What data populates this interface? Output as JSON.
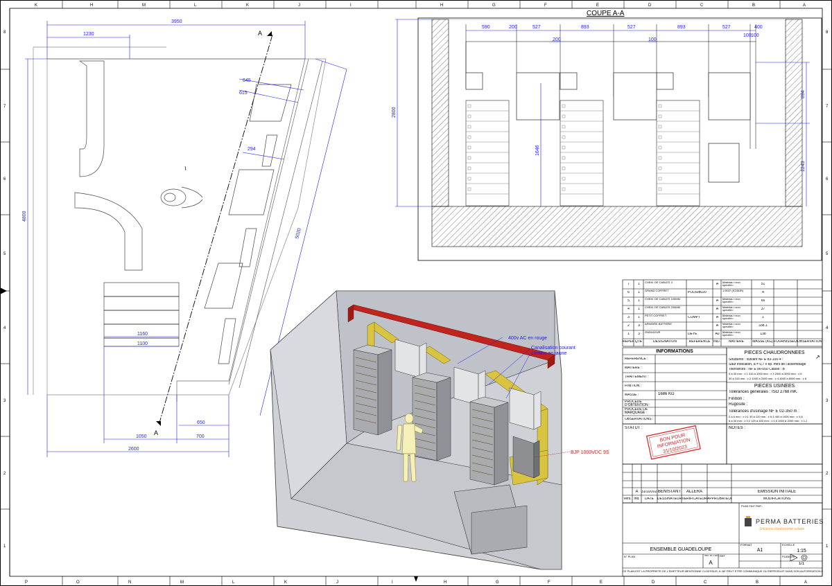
{
  "frame": {
    "col_letters_top": [
      "K",
      "H",
      "M",
      "L",
      "K",
      "J",
      "I",
      "H",
      "G",
      "F",
      "E",
      "D",
      "C",
      "B",
      "A"
    ],
    "col_letters_bottom": [
      "P",
      "O",
      "N",
      "M",
      "L",
      "K",
      "J",
      "I",
      "H",
      "G",
      "F",
      "E",
      "D",
      "C",
      "B",
      "A"
    ],
    "row_numbers_left": [
      "8",
      "7",
      "6",
      "5",
      "4",
      "3",
      "2",
      "1"
    ],
    "row_numbers_right": [
      "8",
      "7",
      "6",
      "5",
      "4",
      "3",
      "2",
      "1"
    ]
  },
  "plan_view": {
    "dims": {
      "top_total": "3950",
      "top_left": "1230",
      "left_height": "4800",
      "diag_long": "5020",
      "d645": "645",
      "d615": "615",
      "d294": "294",
      "w1160": "1160",
      "w1100": "1100",
      "d650": "650",
      "d1050": "1050",
      "d700": "700",
      "bottom_total": "2600"
    },
    "section_marker": "A",
    "section_marker_bottom": "A"
  },
  "section_view": {
    "title": "COUPE A-A",
    "dims": {
      "d590": "590",
      "d200a": "200",
      "d527a": "527",
      "d893a": "893",
      "d527b": "527",
      "d893b": "893",
      "d527c": "527",
      "d400": "400",
      "d100a": "100",
      "d100b": "100",
      "d200b": "200",
      "d100c": "100",
      "height2800": "2800",
      "h1646": "1646",
      "h894": "894",
      "h1243": "1243"
    }
  },
  "iso_view": {
    "labels": {
      "ac": "400v AC en rouge",
      "dc_line1": "Canalisation courant",
      "dc_line2": "continu en jaune",
      "bjp": "BJP 1000VDC 9S"
    }
  },
  "parts_table": {
    "header": [
      "REPERE",
      "QTE",
      "DESIGNATION",
      "REFERENCE",
      "IND.",
      "MATIERE",
      "MASSE (KG)",
      "FOURNISSEUR",
      "OBSERVATIONS"
    ],
    "rows": [
      {
        "rep": "7",
        "qte": "1",
        "des": "CHEM. DE CABLES 3",
        "ref": "",
        "ind": "A",
        "mat": "Matériau <non spécifié>",
        "masse": "51"
      },
      {
        "rep": "6",
        "qte": "1",
        "des": "GRAND COFFRET",
        "ref": "POL608020",
        "ind": "",
        "mat": "1.0037 (S235JR)",
        "masse": "4"
      },
      {
        "rep": "5",
        "qte": "1",
        "des": "CHEM. DE CABLES 100MM",
        "ref": "",
        "ind": "A",
        "mat": "Matériau <non spécifié>",
        "masse": "66"
      },
      {
        "rep": "4",
        "qte": "1",
        "des": "CHEM. DE CABLES 200MM",
        "ref": "",
        "ind": "A",
        "mat": "Matériau <non spécifié>",
        "masse": "37"
      },
      {
        "rep": "3",
        "qte": "1",
        "des": "PETIT COFFRET",
        "ref": "COMPT",
        "ind": "A",
        "mat": "Matériau <non spécifié>",
        "masse": "1"
      },
      {
        "rep": "2",
        "qte": "3",
        "des": "ARMOIRE BATTERIE",
        "ref": "",
        "ind": "A",
        "mat": "Matériau <non spécifié>",
        "masse": "338.1"
      },
      {
        "rep": "1",
        "qte": "3",
        "des": "ONDULEUR",
        "ref": "DEYE",
        "ind": "A0",
        "mat": "Matériau <non spécifié>",
        "masse": "138"
      }
    ]
  },
  "info_block": {
    "title": "INFORMATIONS",
    "labels": [
      "REFERENCE :",
      "MATIERE :",
      "TRAITEMENT :",
      "FINITION :",
      "MASSE :",
      "PROCEDE D'OBTENTION :",
      "PROCEDE DE MARQUAGE :",
      "OBSERVATIONS :"
    ],
    "masse_value": "1686 KG",
    "statut_label": "STATUT :",
    "stamp_line1": "BON POUR",
    "stamp_line2": "INFORMATION",
    "stamp_date": "31/10/2023"
  },
  "chaudronnees": {
    "title": "PIECES CHAUDRONNEES",
    "l1": "Soudures : suivant NF E 83-100-4 :",
    "l2": "Sauf Indication, a = 0,7 x ep. mini de l'assemblage",
    "l3": "Tolérances : NF E 86-050  Classe : B",
    "l4": "0 à 30 mm : ± 1     315 à 1000 mm : ± 3     2000 à 4000 mm : ± 6",
    "l5": "30 à 315 mm : ± 2   1000 à 2000 mm : ± 4    4000 à 8000 mm : ± 8"
  },
  "usinees": {
    "title": "PIECES USINEES",
    "l1": "Tolérances générales : ISO 2768 mK.",
    "l2": "Finition :",
    "l3": "Rugosité :",
    "l4": "Tolérances d'usinage NF E 02-350 m :",
    "l5": "0 à 6 mm : ± 0,1    30 à 120 mm : ± 0,3    400 à 1000 mm : ± 0,8",
    "l6": "6 à 30 mm : ± 0,2   120 à 400 mm : ± 0,5   1000 à 2000 mm : ± 1,2",
    "notes": "NOTES :"
  },
  "revisions": {
    "row": {
      "ver": "A",
      "date": "31/10/2023",
      "dess": "BENISTANT",
      "verif": "ALLERA",
      "approb": "",
      "modif": "EMISSION INITIALE"
    },
    "header": {
      "ver": "Vers.",
      "ind": "Ind.",
      "date": "DATE",
      "dess": "DESSINATEUR",
      "verif": "VERIFICATEUR",
      "approb": "APPROBATEUR",
      "modif": "MODIFICATIONS"
    }
  },
  "cartouche": {
    "plan_par": "PLAN FAIT PAR :",
    "company": "PERMA BATTERIES",
    "tagline": "Solutions d'autonomie solaire",
    "title": "ENSEMBLE GUADELOUPE",
    "format_label": "FORMAT",
    "format_value": "A1",
    "echelle_label": "ECHELLE",
    "echelle_value": "1:15",
    "planche_label": "PLANCHE",
    "planche_value": "1/1",
    "num_plan_label": "N° PLAN",
    "ind_label": "IND. ACTUEL",
    "ind_value": "A",
    "ref_label": "REF",
    "footer": "CE PLAN EST LA PROPRIETE DE L'EMETTEUR MENTIONNE CI-DESSUS, IL NE PEUT ETRE COMMUNIQUE OU REPRODUIT SANS SON AUTORISATION ECRITE"
  },
  "colors": {
    "dimension": "#1a1aff",
    "ac_red": "#c0241c",
    "dc_yellow": "#d8c440",
    "stamp_red": "#d42222",
    "brand_orange": "#e7a13c",
    "hatch": "#444444"
  }
}
